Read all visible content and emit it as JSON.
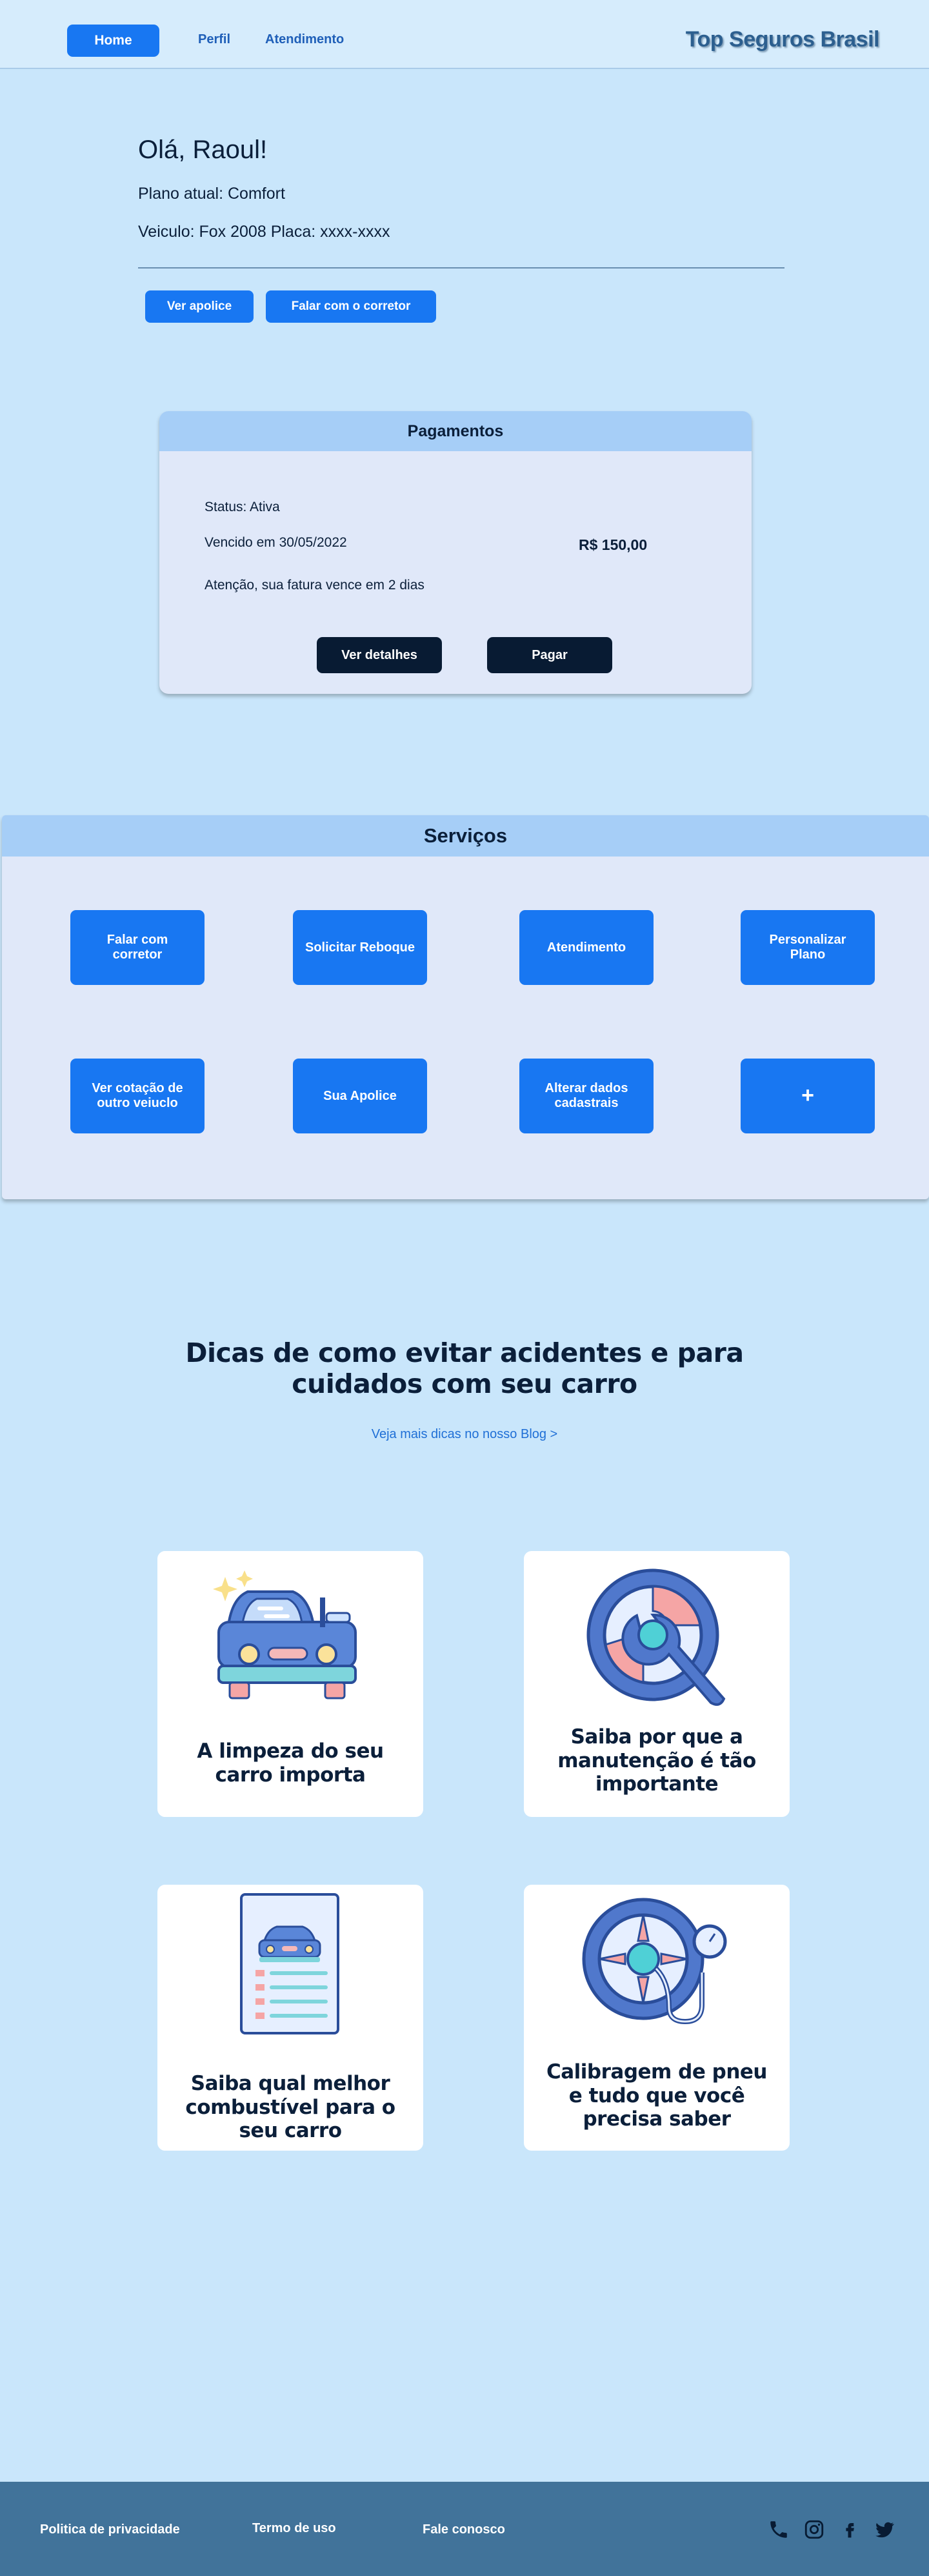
{
  "header": {
    "nav": {
      "home": "Home",
      "perfil": "Perfil",
      "atendimento": "Atendimento"
    },
    "brand": "Top Seguros Brasil"
  },
  "profile": {
    "greeting": "Olá, Raoul!",
    "plan": "Plano atual: Comfort",
    "vehicle": "Veiculo: Fox 2008 Placa: xxxx-xxxx",
    "ver_apolice": "Ver apolice",
    "falar_corretor": "Falar com o corretor"
  },
  "payments": {
    "title": "Pagamentos",
    "status": "Status: Ativa",
    "due": "Vencido em 30/05/2022",
    "amount": "R$ 150,00",
    "warning": "Atenção, sua fatura vence em 2 dias",
    "details_button": "Ver detalhes",
    "pay_button": "Pagar"
  },
  "services": {
    "title": "Serviços",
    "items": [
      {
        "label": "Falar com corretor"
      },
      {
        "label": "Solicitar Reboque"
      },
      {
        "label": "Atendimento"
      },
      {
        "label": "Personalizar Plano"
      },
      {
        "label": "Ver cotação de outro veiuclo"
      },
      {
        "label": "Sua Apolice"
      },
      {
        "label": "Alterar dados cadastrais"
      },
      {
        "label": "+"
      }
    ]
  },
  "tips": {
    "title": "Dicas de como evitar acidentes e para cuidados com seu carro",
    "blog_link": "Veja mais dicas no nosso Blog   >",
    "cards": [
      {
        "text": "A limpeza do seu carro importa",
        "icon": "car-wash-icon"
      },
      {
        "text": "Saiba por que a manutenção é tão importante",
        "icon": "wrench-wheel-icon"
      },
      {
        "text": "Saiba qual melhor combustível para o seu carro",
        "icon": "fuel-checklist-icon"
      },
      {
        "text": "Calibragem de pneu e tudo que você precisa saber",
        "icon": "tire-pressure-icon"
      }
    ]
  },
  "footer": {
    "privacy": "Politica de privacidade",
    "terms": "Termo de uso",
    "contact": "Fale conosco",
    "social_icons": [
      "phone-icon",
      "instagram-icon",
      "facebook-icon",
      "twitter-icon"
    ]
  },
  "colors": {
    "background": "#c9e6fb",
    "primary": "#1877f2",
    "dark": "#081b33",
    "footer": "#41739a"
  }
}
